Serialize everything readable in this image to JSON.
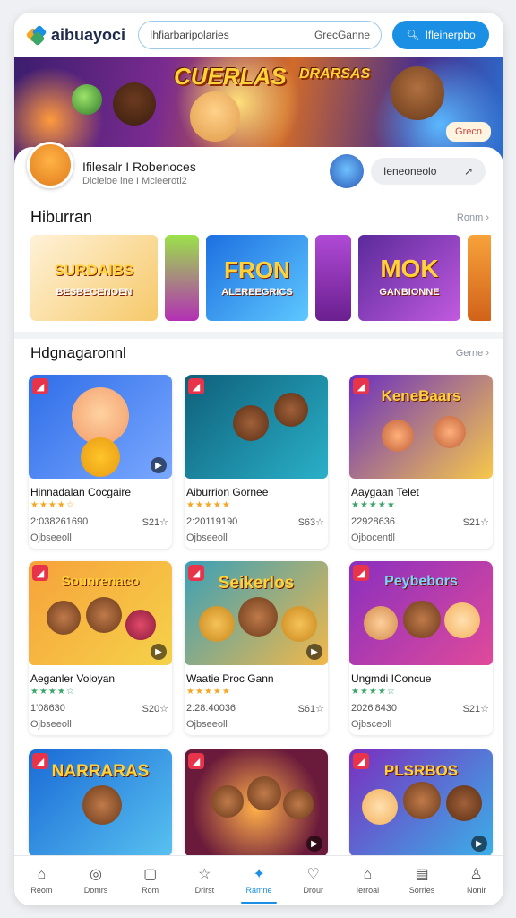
{
  "app": {
    "logo_text": "aibuayoci"
  },
  "search": {
    "placeholder": "Ihfiarbaripolaries",
    "right_text": "GrecGanne"
  },
  "signin": {
    "label": "Ifleinerpbo"
  },
  "hero": {
    "title_left": "CUERLAS",
    "title_right": "DRARSAS",
    "chip": "Grecn"
  },
  "profile": {
    "name": "Ifilesalr I Robenoces",
    "sub": "Dicleloe ine I Mcleeroti2",
    "follow_label": "Ieneoneolo",
    "follow_icon": "arrow-icon"
  },
  "sections": {
    "hiburran": {
      "title": "Hiburran",
      "link": "Ronm"
    },
    "popular": {
      "title": "Hdgnagaronnl",
      "link": "Gerne"
    }
  },
  "strip_tiles": [
    {
      "title": "SURDAIBS",
      "sub": "BESBECENOEN"
    },
    {
      "title": "",
      "sub": ""
    },
    {
      "title": "FRON",
      "sub": "ALEREEGRICS"
    },
    {
      "title": "",
      "sub": ""
    },
    {
      "title": "MOK",
      "sub": "GANBIONNE"
    },
    {
      "title": "",
      "sub": ""
    }
  ],
  "cards": [
    {
      "title": "",
      "name": "Hinnadalan Cocgaire",
      "stars": "★★★★☆",
      "meta_left": "2:038261690",
      "meta_right": "S21☆",
      "foot": "Ojbseeoll"
    },
    {
      "title": "",
      "name": "Aiburrion Gornee",
      "stars": "★★★★★",
      "meta_left": "2:20119190",
      "meta_right": "S63☆",
      "foot": "Ojbseeoll"
    },
    {
      "title": "KeneBaars",
      "name": "Aaygaan Telet",
      "stars": "★★★★★",
      "meta_left": "22928636",
      "meta_right": "S21☆",
      "foot": "Ojbocentll"
    },
    {
      "title": "Sounrenaco",
      "name": "Aeganler Voloyan",
      "stars": "★★★★☆",
      "meta_left": "1'08630",
      "meta_right": "S20☆",
      "foot": "Ojbseeoll"
    },
    {
      "title": "Seikerlos",
      "name": "Waatie Proc Gann",
      "stars": "★★★★★",
      "meta_left": "2:28:40036",
      "meta_right": "S61☆",
      "foot": "Ojbseeoll"
    },
    {
      "title": "Peybebors",
      "name": "Ungmdi IConcue",
      "stars": "★★★★☆",
      "meta_left": "2026'8430",
      "meta_right": "S21☆",
      "foot": "Ojbsceoll"
    },
    {
      "title": "NARRARAS",
      "name": "",
      "stars": "",
      "meta_left": "",
      "meta_right": "",
      "foot": ""
    },
    {
      "title": "",
      "name": "",
      "stars": "",
      "meta_left": "",
      "meta_right": "",
      "foot": ""
    },
    {
      "title": "PLSRBOS",
      "name": "",
      "stars": "",
      "meta_left": "",
      "meta_right": "",
      "foot": ""
    }
  ],
  "nav": [
    {
      "label": "Reom",
      "icon": "home-icon",
      "glyph": "⌂",
      "active": false
    },
    {
      "label": "Domrs",
      "icon": "compass-icon",
      "glyph": "◎",
      "active": false
    },
    {
      "label": "Rom",
      "icon": "tablet-icon",
      "glyph": "▢",
      "active": false
    },
    {
      "label": "Drirst",
      "icon": "star-icon",
      "glyph": "☆",
      "active": false
    },
    {
      "label": "Ramne",
      "icon": "game-icon",
      "glyph": "✦",
      "active": true
    },
    {
      "label": "Drour",
      "icon": "heart-icon",
      "glyph": "♡",
      "active": false
    },
    {
      "label": "Ierroal",
      "icon": "store-icon",
      "glyph": "⌂",
      "active": false
    },
    {
      "label": "Sorries",
      "icon": "library-icon",
      "glyph": "▤",
      "active": false
    },
    {
      "label": "Nonir",
      "icon": "profile-icon",
      "glyph": "♙",
      "active": false
    }
  ]
}
